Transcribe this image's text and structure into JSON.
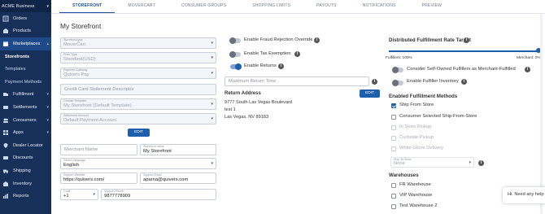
{
  "sidebar": {
    "business": "ACME Business",
    "items": [
      {
        "label": "Orders",
        "icon": "orders-icon"
      },
      {
        "label": "Products",
        "icon": "products-icon"
      },
      {
        "label": "Marketplaces",
        "icon": "marketplaces-icon"
      },
      {
        "label": "Storefronts",
        "sub": true
      },
      {
        "label": "Templates",
        "sub": true
      },
      {
        "label": "Payment Methods",
        "sub": true
      },
      {
        "label": "Fulfillment",
        "icon": "fulfillment-icon"
      },
      {
        "label": "Settlements",
        "icon": "settlements-icon"
      },
      {
        "label": "Consumers",
        "icon": "consumers-icon"
      },
      {
        "label": "Apps",
        "icon": "apps-icon"
      },
      {
        "label": "Dealer Locator",
        "icon": "dealer-locator-icon"
      },
      {
        "label": "Discounts",
        "icon": "discounts-icon"
      },
      {
        "label": "Shipping",
        "icon": "shipping-icon"
      },
      {
        "label": "Inventory",
        "icon": "inventory-icon"
      },
      {
        "label": "Reports",
        "icon": "reports-icon"
      }
    ]
  },
  "tabs": [
    "STOREFRONT",
    "MOVERCART",
    "CONSUMER GROUPS",
    "SHOPPING LIMITS",
    "PAYOUTS",
    "NOTIFICATIONS",
    "PREVIEW"
  ],
  "page_title": "My Storefront",
  "left_form": {
    "storefront_type_label": "Storefront type",
    "storefront_type_value": "MoverCart",
    "price_type_label": "Price Type",
    "price_type_value": "Standard(USD)",
    "payment_gateway_label": "Payment Gateway",
    "payment_gateway_value": "Quivers Pay",
    "statement_descriptor_placeholder": "Credit Card Statement Descriptor",
    "choose_template_label": "Choose Template",
    "choose_template_value": "My Storefront (Default Template)",
    "settlement_account_label": "Settlement Account",
    "settlement_account_value": "Default Payment Account",
    "edit_label": "EDIT",
    "merchant_name_placeholder": "Merchant Name",
    "storefront_name_label": "Storefront name",
    "storefront_name_value": "My Storefront",
    "language_label": "Select Language",
    "language_value": "English",
    "support_website_label": "Support Website",
    "support_website_value": "https://quivers.com/",
    "support_email_label": "Support Email",
    "support_email_value": "aparna@quivers.com",
    "code_label": "Code",
    "code_value": "+1",
    "support_phone_label": "Support Phone",
    "support_phone_value": "9877778909"
  },
  "middle": {
    "fraud_label": "Enable Fraud Rejection Override",
    "tax_label": "Enable Tax Exemption",
    "returns_label": "Enable Returns",
    "fraud_on": false,
    "tax_on": false,
    "returns_on": true,
    "max_return_placeholder": "Maximum Return Time",
    "edit_label": "EDIT",
    "return_address_title": "Return Address",
    "address_line1": "9777 South Las Vegas Boulevard",
    "address_line2": "test 1",
    "address_line3": "Las Vegas, NV 89183"
  },
  "right": {
    "rate_title": "Distributed Fulfillment Rate Target",
    "fulfillers_label": "Fulfillers: 100%",
    "merchant_label": "Merchant: 0%",
    "fulfillers_pct": 100,
    "self_owned_label": "Consider Self-Owned Fulfillers as Merchant-Fulfilled",
    "fulfiller_inventory_label": "Enable Fulfiller Inventory",
    "methods_title": "Enabled Fulfillment Methods",
    "methods": [
      {
        "label": "Ship From Store",
        "checked": true,
        "disabled": false
      },
      {
        "label": "Consumer Selected Ship-From-Store",
        "checked": false,
        "disabled": false
      },
      {
        "label": "In Store Pickup",
        "checked": false,
        "disabled": true
      },
      {
        "label": "Curbside Pickup",
        "checked": false,
        "disabled": true
      },
      {
        "label": "White Glove Delivery",
        "checked": false,
        "disabled": true
      }
    ],
    "ship_to_store_label": "Ship To Store",
    "ship_to_store_value": "None",
    "warehouses_title": "Warehouses",
    "warehouses": [
      {
        "label": "FR Warehouse",
        "checked": false
      },
      {
        "label": "VIP Warehouse",
        "checked": false
      },
      {
        "label": "Test Warehouse 2",
        "checked": false
      }
    ]
  },
  "chat": {
    "text": "Hi. Need any help"
  },
  "colors": {
    "sidebar": "#17305a",
    "accent": "#1d5fae"
  }
}
